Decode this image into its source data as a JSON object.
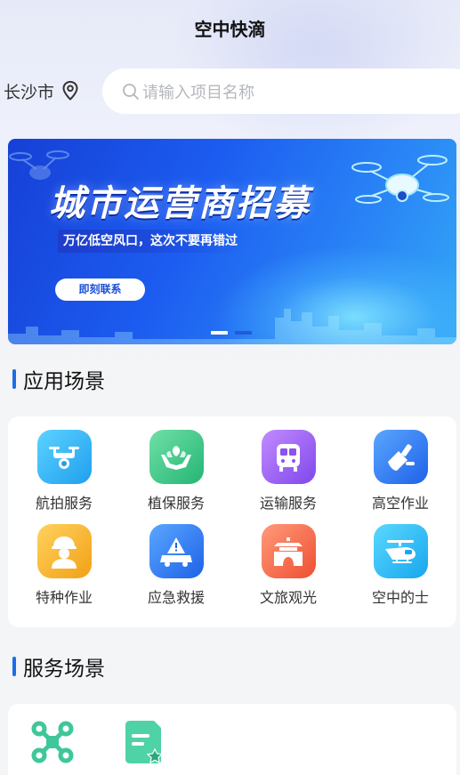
{
  "header": {
    "title": "空中快滴"
  },
  "location": {
    "city": "长沙市"
  },
  "search": {
    "placeholder": "请输入项目名称"
  },
  "banner": {
    "title": "城市运营商招募",
    "subtitle": "万亿低空风口，这次不要再错过",
    "cta": "即刻联系",
    "slide_count": 2,
    "active_slide": 1
  },
  "sections": {
    "apps_title": "应用场景",
    "services_title": "服务场景"
  },
  "apps": [
    {
      "label": "航拍服务",
      "icon": "aerial-drone-icon",
      "color": "#27aef0"
    },
    {
      "label": "植保服务",
      "icon": "plant-protection-icon",
      "color": "#32c48a"
    },
    {
      "label": "运输服务",
      "icon": "transport-bus-icon",
      "color": "#9b5cf0"
    },
    {
      "label": "高空作业",
      "icon": "high-altitude-work-icon",
      "color": "#2f7cf5"
    },
    {
      "label": "特种作业",
      "icon": "special-worker-icon",
      "color": "#f5b52a"
    },
    {
      "label": "应急救援",
      "icon": "emergency-rescue-icon",
      "color": "#2f7cf5"
    },
    {
      "label": "文旅观光",
      "icon": "tourism-gate-icon",
      "color": "#f56a4a"
    },
    {
      "label": "空中的士",
      "icon": "air-taxi-helicopter-icon",
      "color": "#22b3f0"
    }
  ],
  "services": [
    {
      "icon": "drone-service-icon",
      "color": "#3ec79a"
    },
    {
      "icon": "document-star-icon",
      "color": "#3ec79a"
    }
  ]
}
